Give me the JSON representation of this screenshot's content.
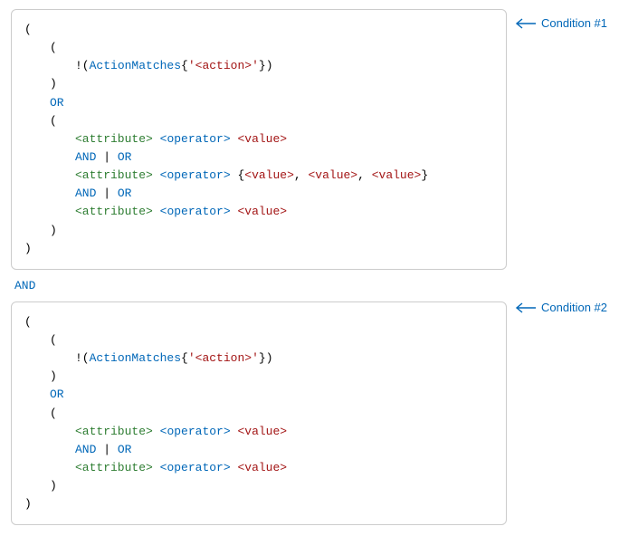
{
  "labels": {
    "callout1": "Condition #1",
    "callout2": "Condition #2",
    "between_and": "AND"
  },
  "tokens": {
    "lparen": "(",
    "rparen": ")",
    "bang_lparen": "!(",
    "lbrace": "{",
    "rbrace": "}",
    "comma_sp": ", ",
    "action_matches": "ActionMatches",
    "action_placeholder": "<action>",
    "squote": "'",
    "or_kw": "OR",
    "and_kw": "AND",
    "pipe": " | ",
    "attribute": "<attribute>",
    "operator": "<operator>",
    "value": "<value>",
    "space": " "
  }
}
